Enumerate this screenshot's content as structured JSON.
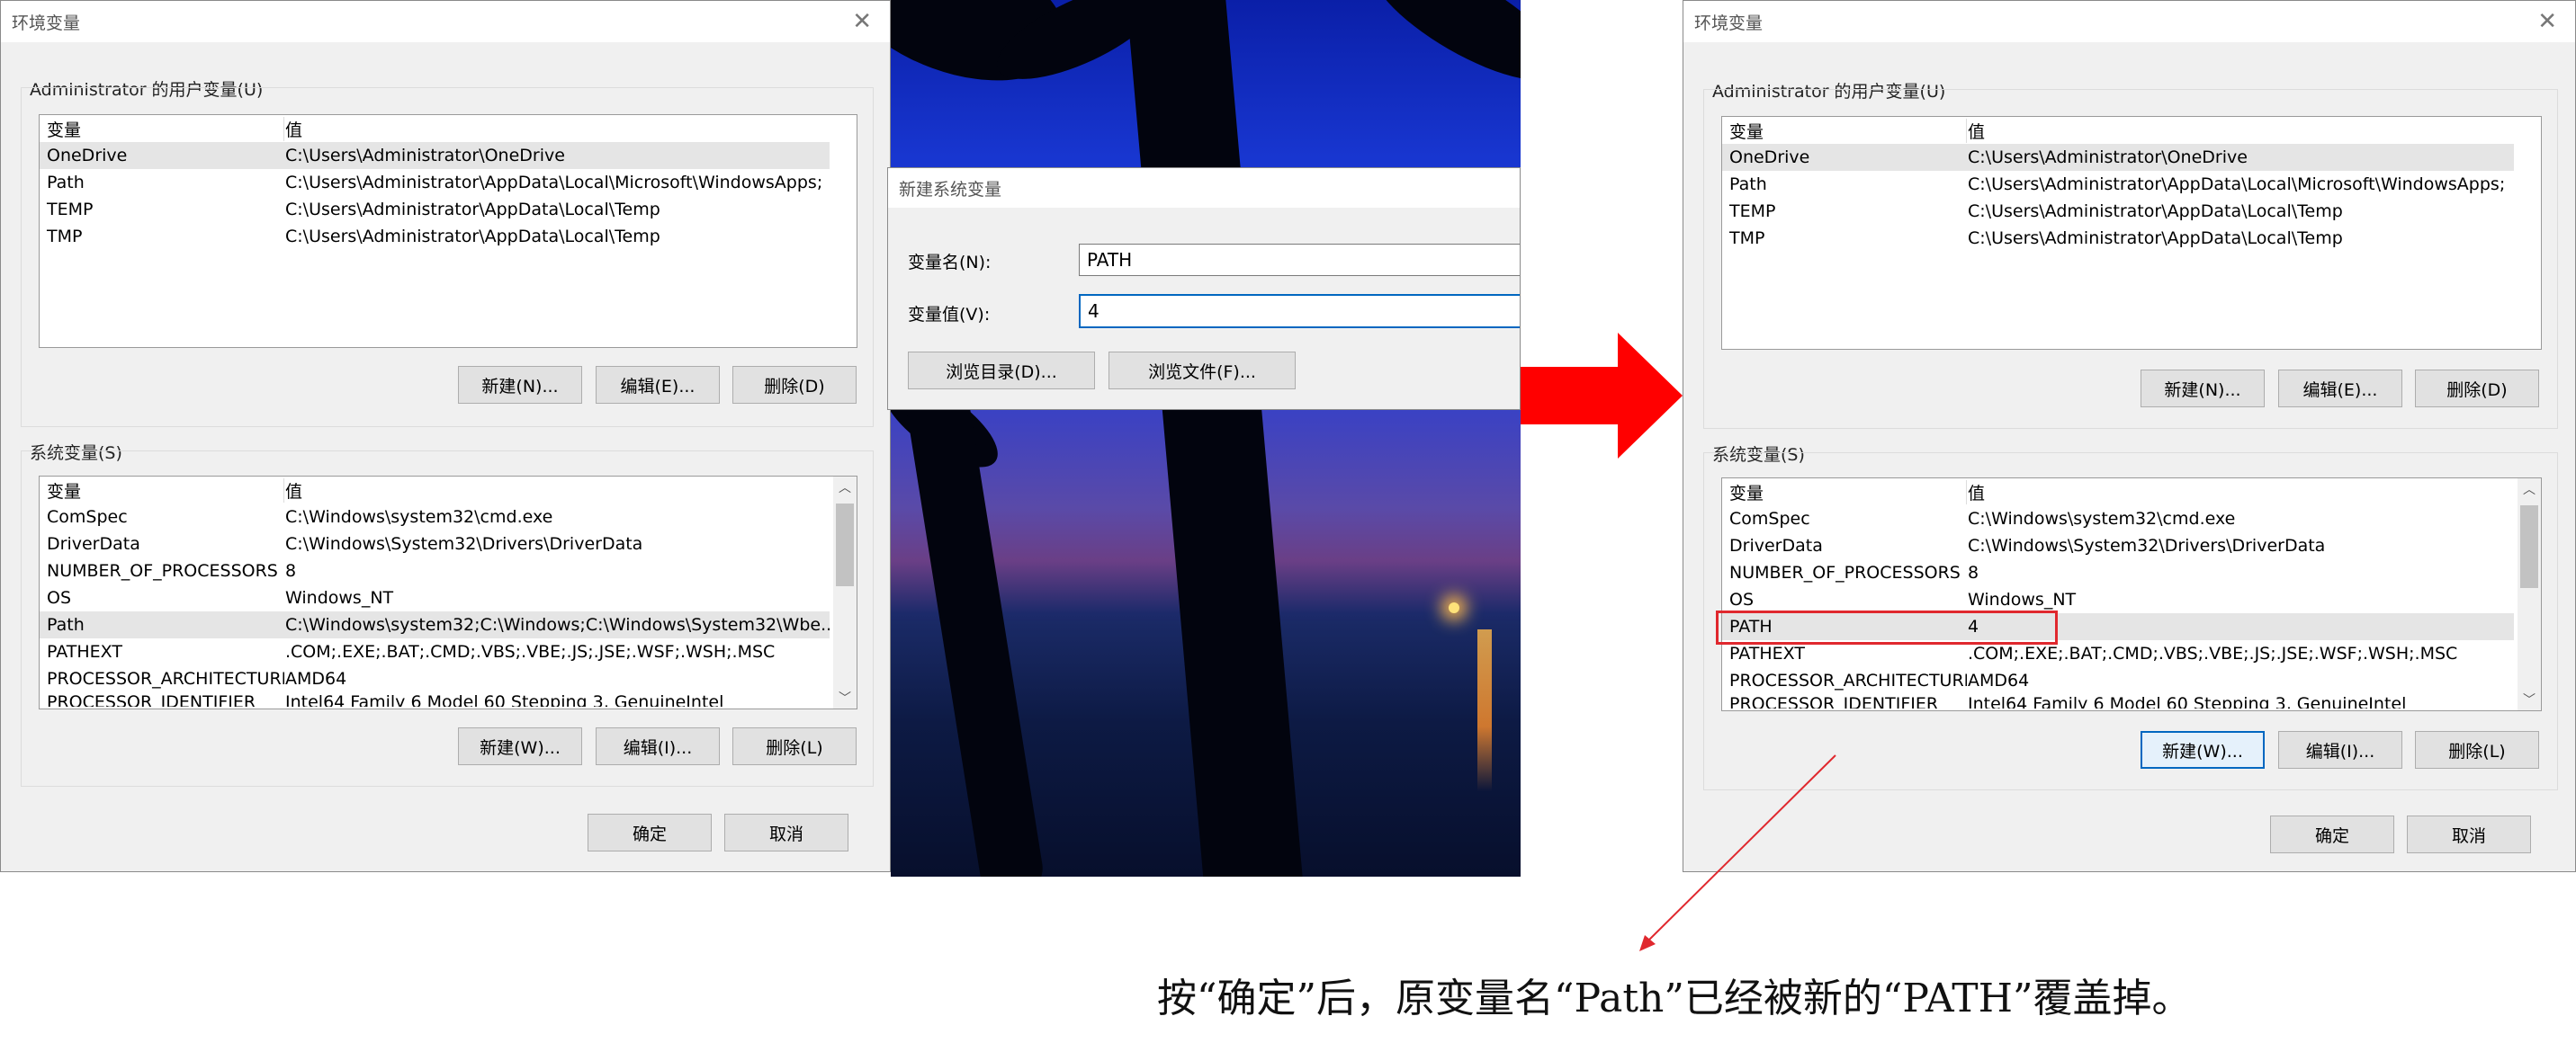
{
  "left_window": {
    "title": "环境变量",
    "user_group_label": "Administrator 的用户变量(U)",
    "header_name": "变量",
    "header_value": "值",
    "user_rows": [
      {
        "name": "OneDrive",
        "value": "C:\\Users\\Administrator\\OneDrive"
      },
      {
        "name": "Path",
        "value": "C:\\Users\\Administrator\\AppData\\Local\\Microsoft\\WindowsApps;"
      },
      {
        "name": "TEMP",
        "value": "C:\\Users\\Administrator\\AppData\\Local\\Temp"
      },
      {
        "name": "TMP",
        "value": "C:\\Users\\Administrator\\AppData\\Local\\Temp"
      }
    ],
    "user_buttons": {
      "new": "新建(N)...",
      "edit": "编辑(E)...",
      "delete": "删除(D)"
    },
    "system_group_label": "系统变量(S)",
    "system_rows": [
      {
        "name": "ComSpec",
        "value": "C:\\Windows\\system32\\cmd.exe"
      },
      {
        "name": "DriverData",
        "value": "C:\\Windows\\System32\\Drivers\\DriverData"
      },
      {
        "name": "NUMBER_OF_PROCESSORS",
        "value": "8"
      },
      {
        "name": "OS",
        "value": "Windows_NT"
      },
      {
        "name": "Path",
        "value": "C:\\Windows\\system32;C:\\Windows;C:\\Windows\\System32\\Wbe..."
      },
      {
        "name": "PATHEXT",
        "value": ".COM;.EXE;.BAT;.CMD;.VBS;.VBE;.JS;.JSE;.WSF;.WSH;.MSC"
      },
      {
        "name": "PROCESSOR_ARCHITECTURE",
        "value": "AMD64"
      },
      {
        "name": "PROCESSOR_IDENTIFIER",
        "value": "Intel64 Family 6 Model 60 Stepping 3, GenuineIntel"
      }
    ],
    "system_buttons": {
      "new": "新建(W)...",
      "edit": "编辑(I)...",
      "delete": "删除(L)"
    },
    "ok": "确定",
    "cancel": "取消"
  },
  "new_var_dialog": {
    "title": "新建系统变量",
    "name_label": "变量名(N):",
    "name_value": "PATH",
    "value_label": "变量值(V):",
    "value_value": "4",
    "browse_dir": "浏览目录(D)...",
    "browse_file": "浏览文件(F)..."
  },
  "right_window": {
    "title": "环境变量",
    "user_group_label": "Administrator 的用户变量(U)",
    "header_name": "变量",
    "header_value": "值",
    "user_rows": [
      {
        "name": "OneDrive",
        "value": "C:\\Users\\Administrator\\OneDrive"
      },
      {
        "name": "Path",
        "value": "C:\\Users\\Administrator\\AppData\\Local\\Microsoft\\WindowsApps;"
      },
      {
        "name": "TEMP",
        "value": "C:\\Users\\Administrator\\AppData\\Local\\Temp"
      },
      {
        "name": "TMP",
        "value": "C:\\Users\\Administrator\\AppData\\Local\\Temp"
      }
    ],
    "user_buttons": {
      "new": "新建(N)...",
      "edit": "编辑(E)...",
      "delete": "删除(D)"
    },
    "system_group_label": "系统变量(S)",
    "system_rows": [
      {
        "name": "ComSpec",
        "value": "C:\\Windows\\system32\\cmd.exe"
      },
      {
        "name": "DriverData",
        "value": "C:\\Windows\\System32\\Drivers\\DriverData"
      },
      {
        "name": "NUMBER_OF_PROCESSORS",
        "value": "8"
      },
      {
        "name": "OS",
        "value": "Windows_NT"
      },
      {
        "name": "PATH",
        "value": "4"
      },
      {
        "name": "PATHEXT",
        "value": ".COM;.EXE;.BAT;.CMD;.VBS;.VBE;.JS;.JSE;.WSF;.WSH;.MSC"
      },
      {
        "name": "PROCESSOR_ARCHITECTURE",
        "value": "AMD64"
      },
      {
        "name": "PROCESSOR_IDENTIFIER",
        "value": "Intel64 Family 6 Model 60 Stepping 3, GenuineIntel"
      }
    ],
    "system_buttons": {
      "new": "新建(W)...",
      "edit": "编辑(I)...",
      "delete": "删除(L)"
    },
    "ok": "确定",
    "cancel": "取消"
  },
  "caption": "按“确定”后，原变量名“Path”已经被新的“PATH”覆盖掉。",
  "colors": {
    "highlight_box": "#e0282e",
    "arrow": "#ff0000",
    "annotation_line": "#e0282e"
  }
}
